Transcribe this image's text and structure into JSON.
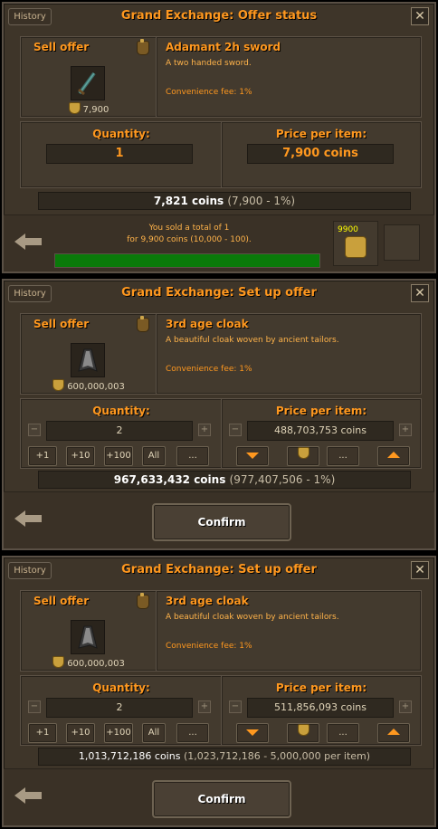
{
  "panels": [
    {
      "history": "History",
      "title": "Grand Exchange: Offer status",
      "offer_type": "Sell offer",
      "item_name": "Adamant 2h sword",
      "item_desc": "A two handed sword.",
      "fee": "Convenience fee: 1%",
      "item_price": "7,900",
      "quantity_label": "Quantity:",
      "quantity": "1",
      "price_label": "Price per item:",
      "price": "7,900 coins",
      "total_main": "7,821 coins",
      "total_sub": "(7,900 - 1%)",
      "sold_line1": "You sold a total of 1",
      "sold_line2": "for 9,900 coins (10,000 - 100).",
      "progress": 1.0,
      "coin_count": "9900"
    },
    {
      "history": "History",
      "title": "Grand Exchange: Set up offer",
      "offer_type": "Sell offer",
      "item_name": "3rd age cloak",
      "item_desc": "A beautiful cloak woven by ancient tailors.",
      "fee": "Convenience fee: 1%",
      "item_price": "600,000,003",
      "quantity_label": "Quantity:",
      "quantity": "2",
      "price_label": "Price per item:",
      "price": "488,703,753 coins",
      "total_main": "967,633,432 coins",
      "total_sub": "(977,407,506 - 1%)",
      "confirm": "Confirm"
    },
    {
      "history": "History",
      "title": "Grand Exchange: Set up offer",
      "offer_type": "Sell offer",
      "item_name": "3rd age cloak",
      "item_desc": "A beautiful cloak woven by ancient tailors.",
      "fee": "Convenience fee: 1%",
      "item_price": "600,000,003",
      "quantity_label": "Quantity:",
      "quantity": "2",
      "price_label": "Price per item:",
      "price": "511,856,093 coins",
      "total_main": "1,013,712,186 coins",
      "total_sub": "(1,023,712,186 - 5,000,000 per item)",
      "confirm": "Confirm"
    }
  ],
  "buttons": {
    "minus": "−",
    "plus": "+",
    "plus1": "+1",
    "plus10": "+10",
    "plus100": "+100",
    "all": "All",
    "more": "...",
    "close": "✕"
  }
}
